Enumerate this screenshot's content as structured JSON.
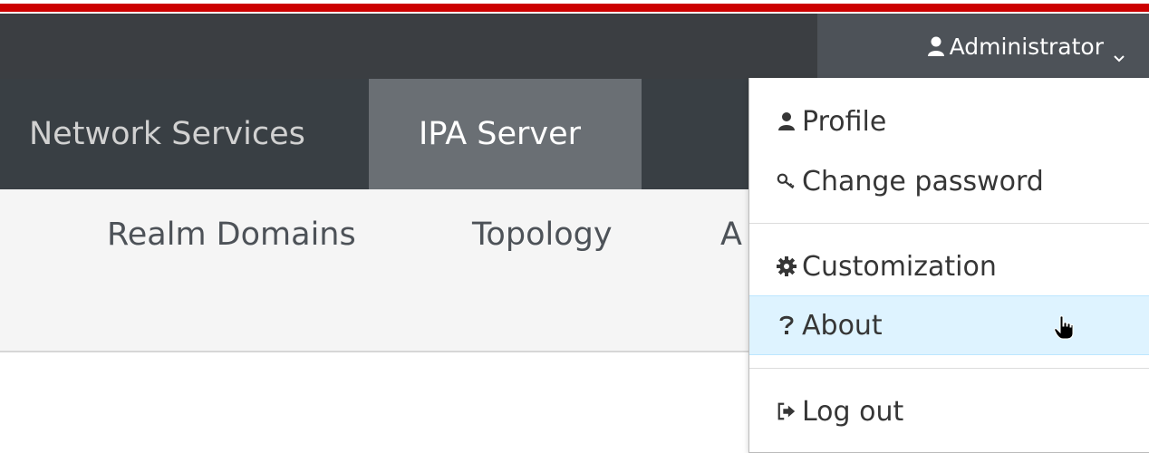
{
  "header": {
    "user_menu": {
      "label": "Administrator",
      "icon": "user-icon"
    }
  },
  "nav": {
    "primary": [
      {
        "label": "Network Services",
        "active": false
      },
      {
        "label": "IPA Server",
        "active": true
      }
    ],
    "secondary": [
      {
        "label": "Realm Domains"
      },
      {
        "label": "Topology"
      },
      {
        "label": "A"
      }
    ]
  },
  "user_dropdown": {
    "items": [
      {
        "label": "Profile",
        "icon": "user-icon"
      },
      {
        "label": "Change password",
        "icon": "key-icon"
      },
      {
        "label": "Customization",
        "icon": "gear-icon"
      },
      {
        "label": "About",
        "icon": "question-icon",
        "hovered": true
      },
      {
        "label": "Log out",
        "icon": "logout-icon"
      }
    ]
  },
  "colors": {
    "accent_red": "#cc0000",
    "masthead": "#3b3e42",
    "nav_active": "#6a6f74",
    "hover": "#def3ff"
  }
}
